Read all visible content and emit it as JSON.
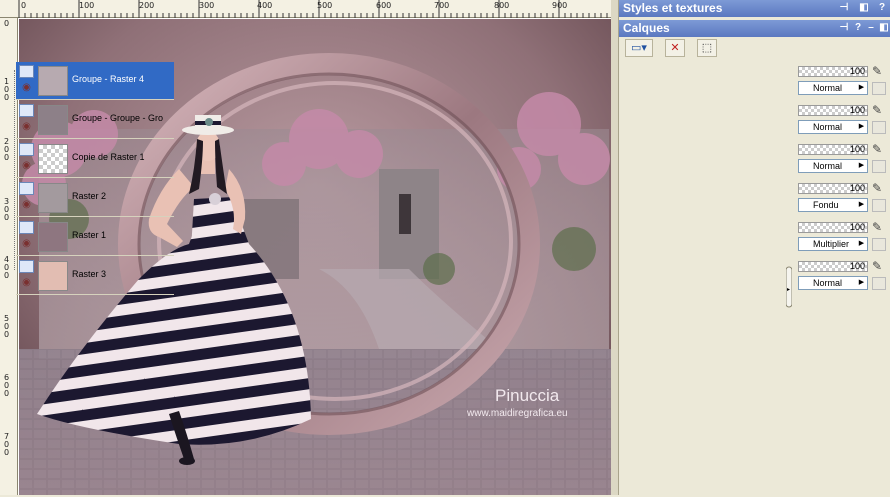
{
  "ruler": {
    "top_labels": [
      "0",
      "100",
      "200",
      "300",
      "400",
      "500",
      "600",
      "700",
      "800",
      "900"
    ],
    "left_labels": [
      "0",
      "1 0 0",
      "2 0 0",
      "3 0 0",
      "4 0 0",
      "5 0 0",
      "6 0 0",
      "7 0 0"
    ]
  },
  "watermark": {
    "name": "Pinuccia",
    "url": "www.maidiregrafica.eu"
  },
  "panels": {
    "styles_title": "Styles et textures",
    "layers_title": "Calques"
  },
  "layers": [
    {
      "name": "Groupe - Raster 4",
      "selected": true,
      "opacity": "100",
      "blend": "Normal"
    },
    {
      "name": "Groupe - Groupe - Gro",
      "selected": false,
      "opacity": "100",
      "blend": "Normal"
    },
    {
      "name": "Copie de Raster 1",
      "selected": false,
      "opacity": "100",
      "blend": "Normal"
    },
    {
      "name": "Raster 2",
      "selected": false,
      "opacity": "100",
      "blend": "Fondu"
    },
    {
      "name": "Raster 1",
      "selected": false,
      "opacity": "100",
      "blend": "Multiplier"
    },
    {
      "name": "Raster 3",
      "selected": false,
      "opacity": "100",
      "blend": "Normal"
    }
  ],
  "icons": {
    "new_layer": "new-layer-icon",
    "delete_layer": "delete-layer-icon",
    "mask": "mask-icon",
    "visibility": "visibility-icon",
    "eye": "eye-icon",
    "brush": "brush-icon"
  },
  "colors": {
    "selection": "#316ac5",
    "titlebar": "#6b88cc",
    "panel_bg": "#ece9d8"
  }
}
